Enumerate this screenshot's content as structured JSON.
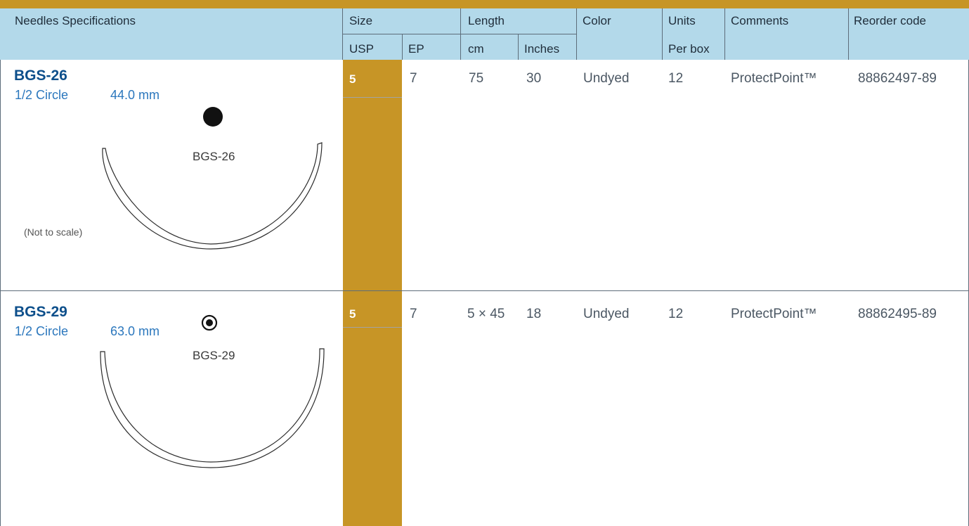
{
  "header": {
    "needles_specifications": "Needles Specifications",
    "size": "Size",
    "usp": "USP",
    "ep": "EP",
    "length": "Length",
    "cm": "cm",
    "inches": "Inches",
    "color": "Color",
    "units": "Units",
    "per_box": "Per box",
    "comments": "Comments",
    "reorder_code": "Reorder code"
  },
  "rows": [
    {
      "name": "BGS-26",
      "shape": "1/2 Circle",
      "size_mm": "44.0 mm",
      "drawing_label": "BGS-26",
      "note": "(Not to scale)",
      "usp": "5",
      "ep": "7",
      "cm": "75",
      "inches": "30",
      "color": "Undyed",
      "units": "12",
      "comments": "ProtectPoint™",
      "reorder_code": "88862497-89"
    },
    {
      "name": "BGS-29",
      "shape": "1/2 Circle",
      "size_mm": "63.0 mm",
      "drawing_label": "BGS-29",
      "usp": "5",
      "ep": "7",
      "cm": "5 × 45",
      "inches": "18",
      "color": "Undyed",
      "units": "12",
      "comments": "ProtectPoint™",
      "reorder_code": "88862495-89"
    }
  ],
  "colors": {
    "accent_gold": "#c79526",
    "header_blue": "#b3d9ea",
    "name_blue": "#0d4f8b",
    "sub_blue": "#2b77bd"
  }
}
